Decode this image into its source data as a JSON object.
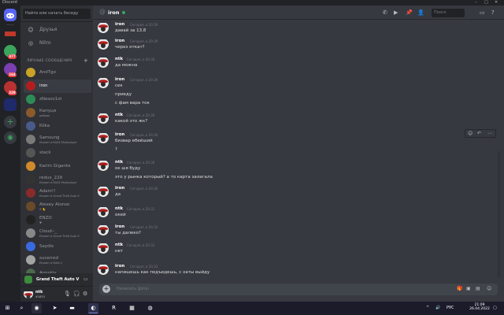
{
  "window": {
    "title": "Discord"
  },
  "server_rail": {
    "badges": [
      "477",
      "164",
      "229"
    ]
  },
  "sidebar": {
    "search_placeholder": "Найти или начать беседу",
    "nav": [
      {
        "label": "Друзья",
        "icon": "friends-icon"
      },
      {
        "label": "Nitro",
        "icon": "nitro-icon"
      }
    ],
    "dm_header": "ЛИЧНЫЕ СООБЩЕНИЯ",
    "dms": [
      {
        "name": "AndTgo",
        "status": ""
      },
      {
        "name": "iron",
        "status": "",
        "active": true
      },
      {
        "name": "zNesov1st",
        "status": ""
      },
      {
        "name": "Капуця",
        "status": "добряк"
      },
      {
        "name": "Kilka",
        "status": ""
      },
      {
        "name": "Samsung",
        "status": "Играет в RAGE Multiplayer"
      },
      {
        "name": "stack",
        "status": ""
      },
      {
        "name": "Karim Gigante",
        "status": ""
      },
      {
        "name": "redux_229",
        "status": "Играет в RAGE Multiplayer"
      },
      {
        "name": "Adam!!",
        "status": "Играет в Grand Theft Auto V"
      },
      {
        "name": "Alexey Alonso",
        "status": "Я 🐈"
      },
      {
        "name": "ENZO",
        "status": "♥"
      },
      {
        "name": "Cloud-:_",
        "status": "Играет в Grand Theft Auto V"
      },
      {
        "name": "Saydis",
        "status": ""
      },
      {
        "name": "sucerred",
        "status": "Играет в Dota 2"
      },
      {
        "name": "Apnskiy",
        "status": ""
      }
    ],
    "now_playing": "Grand Theft Auto V",
    "user": {
      "name": "ntk",
      "tag": "#1653"
    }
  },
  "chat": {
    "channel": "iron",
    "search_placeholder": "Поиск",
    "composer_placeholder": "Написать @iron",
    "messages": [
      {
        "author": "iron",
        "time": "Сегодня, в 20:29",
        "lines": [
          "давай за 13.8"
        ]
      },
      {
        "author": "iron",
        "time": "Сегодня, в 20:29",
        "lines": [
          "через откат?"
        ]
      },
      {
        "author": "ntk",
        "time": "Сегодня, в 20:30",
        "lines": [
          "да можна"
        ]
      },
      {
        "author": "iron",
        "time": "Сегодня, в 20:30",
        "lines": [
          "сек",
          "приеду",
          "с фам вара ток"
        ]
      },
      {
        "author": "ntk",
        "time": "Сегодня, в 20:30",
        "lines": [
          "какой это жк?"
        ]
      },
      {
        "author": "iron",
        "time": "Сегодня, в 20:30",
        "lines": [
          "бизвар ебейший",
          "?"
        ]
      },
      {
        "author": "ntk",
        "time": "Сегодня, в 20:30",
        "lines": [
          "ок шя буду",
          "это у рынка который? а то карта залагала"
        ]
      },
      {
        "author": "iron",
        "time": "Сегодня, в 20:30",
        "lines": [
          "да"
        ]
      },
      {
        "author": "ntk",
        "time": "Сегодня, в 20:31",
        "lines": [
          "окей"
        ]
      },
      {
        "author": "iron",
        "time": "Сегодня, в 20:32",
        "lines": [
          "ты далеко?"
        ]
      },
      {
        "author": "ntk",
        "time": "Сегодня, в 20:32",
        "lines": [
          "нет"
        ]
      },
      {
        "author": "iron",
        "time": "Сегодня, в 20:33",
        "lines": [
          "напишешь как подъедешь, с хаты выйду"
        ]
      }
    ]
  },
  "taskbar": {
    "time": "21:09",
    "date": "26.04.2022",
    "lang": "РУС"
  },
  "colors": {
    "accent": "#5865f2",
    "online": "#3ba55d",
    "badge": "#ed4245"
  }
}
